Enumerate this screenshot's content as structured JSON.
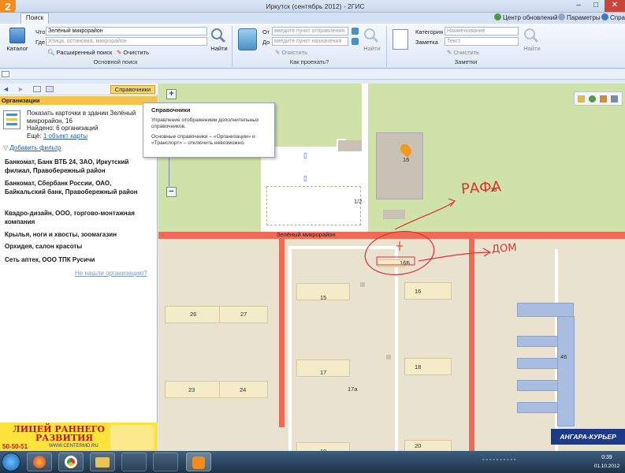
{
  "window": {
    "title": "Иркутск (сентябрь 2012) - 2ГИС",
    "logo": "2",
    "controls": [
      "–",
      "□",
      "✕"
    ]
  },
  "tabs": {
    "search": "Поиск"
  },
  "top_links": {
    "updates": "Центр обновлений",
    "params": "Параметры",
    "help": "Справ"
  },
  "ribbon": {
    "catalog": "Каталог",
    "search_group": {
      "what_label": "Что",
      "what_value": "Зелёный микрорайон",
      "where_label": "Где",
      "where_placeholder": "Улица, остановка, микрорайон",
      "advanced": "Расширенный поиск",
      "clear": "Очистить",
      "find": "Найти",
      "caption": "Основной поиск"
    },
    "route_group": {
      "from_label": "От",
      "from_placeholder": "введите пункт отправления",
      "to_label": "До",
      "to_placeholder": "введите пункт назначения",
      "clear": "Очистить",
      "find": "Найти",
      "caption": "Как проехать?"
    },
    "notes_group": {
      "category_label": "Категория",
      "category_placeholder": "Наименование",
      "note_label": "Заметка",
      "note_placeholder": "Текст",
      "clear": "Очистить",
      "find": "Найти",
      "caption": "Заметки"
    }
  },
  "left_panel": {
    "dict_button": "Справочники",
    "header": "Организации",
    "card": {
      "line1": "Показать карточки в здании Зелёный",
      "line2": "микрорайон, 16",
      "found": "Найдено: 6 организаций",
      "more_prefix": "Ещё:",
      "more_link": "1 объект карты"
    },
    "add_filter": "Добавить фильтр",
    "orgs": [
      "Банкомат, Банк ВТБ 24, ЗАО, Иркутский филиал, Правобережный район",
      "Банкомат, Сбербанк России, ОАО, Байкальский банк, Правобережный район",
      "Квадро-дизайн, ООО, торгово-монтажная компания",
      "Крылья, ноги и хвосты, зоомагазин",
      "Орхидея, салон красоты",
      "Сеть аптек, ООО ТПК Русичи"
    ],
    "not_found": "Не нашли организацию?",
    "banner": {
      "line1": "ЛИЦЕЙ РАННЕГО",
      "line2": "РАЗВИТИЯ",
      "phone": "50-50-51",
      "site": "WWW.CENTERMD.RU"
    }
  },
  "tooltip": {
    "title": "Справочники",
    "text1": "Управление отображением дополнительных справочников.",
    "text2": "Основные справочники – «Организации» и «Транспорт» – отключить невозможно."
  },
  "map": {
    "street_label": "Зелёный микрорайон",
    "buildings": [
      "16",
      "1/2",
      "16",
      "16Б",
      "15",
      "16",
      "26",
      "27",
      "17",
      "18",
      "23",
      "24",
      "17а",
      "46",
      "19",
      "20"
    ],
    "annotations": {
      "rafa": "РАФА",
      "dom": "ДОМ"
    },
    "ad_logo": "АНГАРА-КУРЬЕР"
  },
  "taskbar": {
    "time": "0:39",
    "date": "01.10.2012"
  },
  "colors": {
    "accent": "#f5c24a",
    "road": "#ef6a57",
    "park": "#cfe3a8",
    "annotation": "#e0322f"
  }
}
